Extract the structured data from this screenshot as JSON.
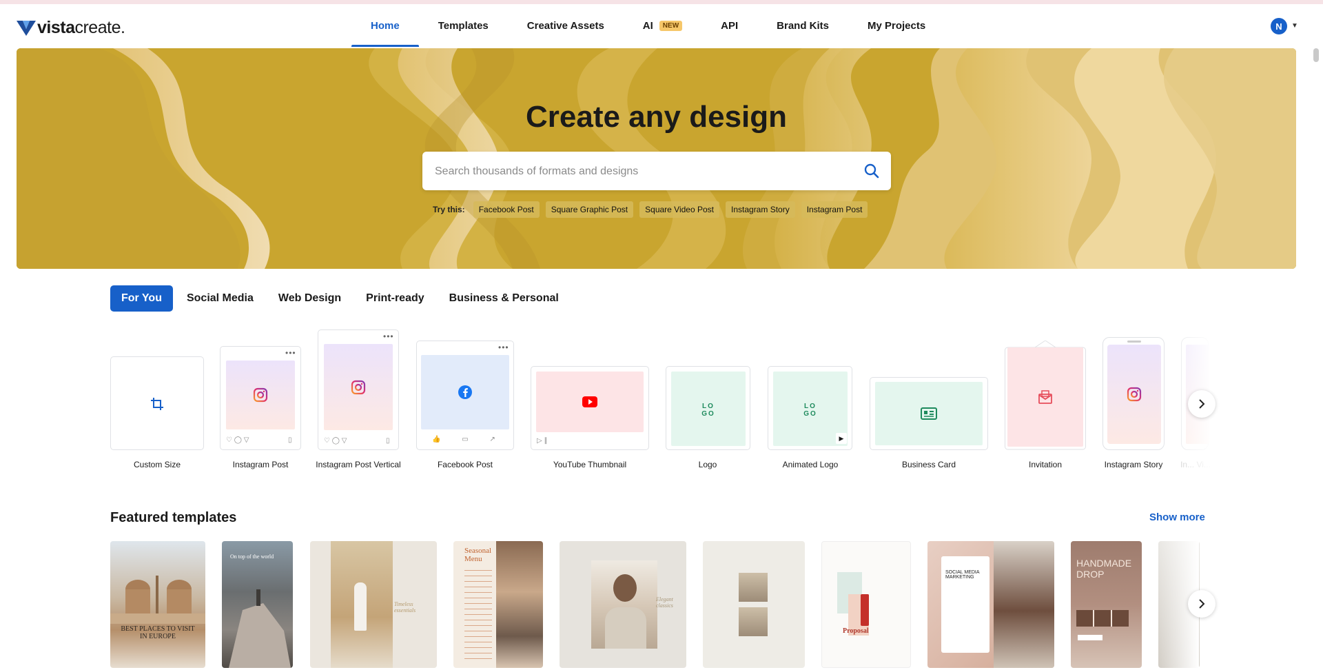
{
  "brand": {
    "logo_bold": "vista",
    "logo_rest": "create",
    "logo_dot": "."
  },
  "nav": {
    "items": [
      "Home",
      "Templates",
      "Creative Assets",
      "AI",
      "API",
      "Brand Kits",
      "My Projects"
    ],
    "active": "Home",
    "ai_badge": "NEW"
  },
  "user": {
    "avatar_initial": "N"
  },
  "hero": {
    "title": "Create any design",
    "search_placeholder": "Search thousands of formats and designs",
    "try_label": "Try this:",
    "suggestions": [
      "Facebook Post",
      "Square Graphic Post",
      "Square Video Post",
      "Instagram Story",
      "Instagram Post"
    ]
  },
  "categories": {
    "items": [
      "For You",
      "Social Media",
      "Web Design",
      "Print-ready",
      "Business & Personal"
    ],
    "active": "For You"
  },
  "formats": {
    "items": [
      {
        "label": "Custom Size",
        "icon": "crop-icon"
      },
      {
        "label": "Instagram Post",
        "icon": "instagram-icon"
      },
      {
        "label": "Instagram Post Vertical",
        "icon": "instagram-icon"
      },
      {
        "label": "Facebook Post",
        "icon": "facebook-icon"
      },
      {
        "label": "YouTube Thumbnail",
        "icon": "youtube-icon"
      },
      {
        "label": "Logo",
        "icon": "logo-icon",
        "text": "LOGO"
      },
      {
        "label": "Animated Logo",
        "icon": "logo-icon",
        "text": "LOGO"
      },
      {
        "label": "Business Card",
        "icon": "id-card-icon"
      },
      {
        "label": "Invitation",
        "icon": "envelope-icon"
      },
      {
        "label": "Instagram Story",
        "icon": "instagram-icon"
      },
      {
        "label": "In... Vi...",
        "icon": "instagram-icon"
      }
    ]
  },
  "featured": {
    "title": "Featured templates",
    "show_more": "Show more",
    "templates": [
      {
        "name": "europe-travel",
        "caption": "BEST PLACES TO VISIT IN EUROPE"
      },
      {
        "name": "top-of-the-world",
        "caption": "On top of the world"
      },
      {
        "name": "timeless-essentials",
        "caption": "Timeless essentials"
      },
      {
        "name": "seasonal-menu",
        "caption": "Seasonal Menu"
      },
      {
        "name": "elegant-classics",
        "caption": "Elegant classics"
      },
      {
        "name": "photo-collage",
        "caption": ""
      },
      {
        "name": "proposal",
        "caption": "Proposal"
      },
      {
        "name": "social-media-marketing",
        "caption": "SOCIAL MEDIA MARKETING"
      },
      {
        "name": "handmade-drop",
        "caption": "HANDMADE DROP"
      },
      {
        "name": "neutral-interior",
        "caption": ""
      }
    ]
  },
  "colors": {
    "accent": "#1760c9",
    "hero": "#ccaa35",
    "badge": "#f6c76a"
  }
}
